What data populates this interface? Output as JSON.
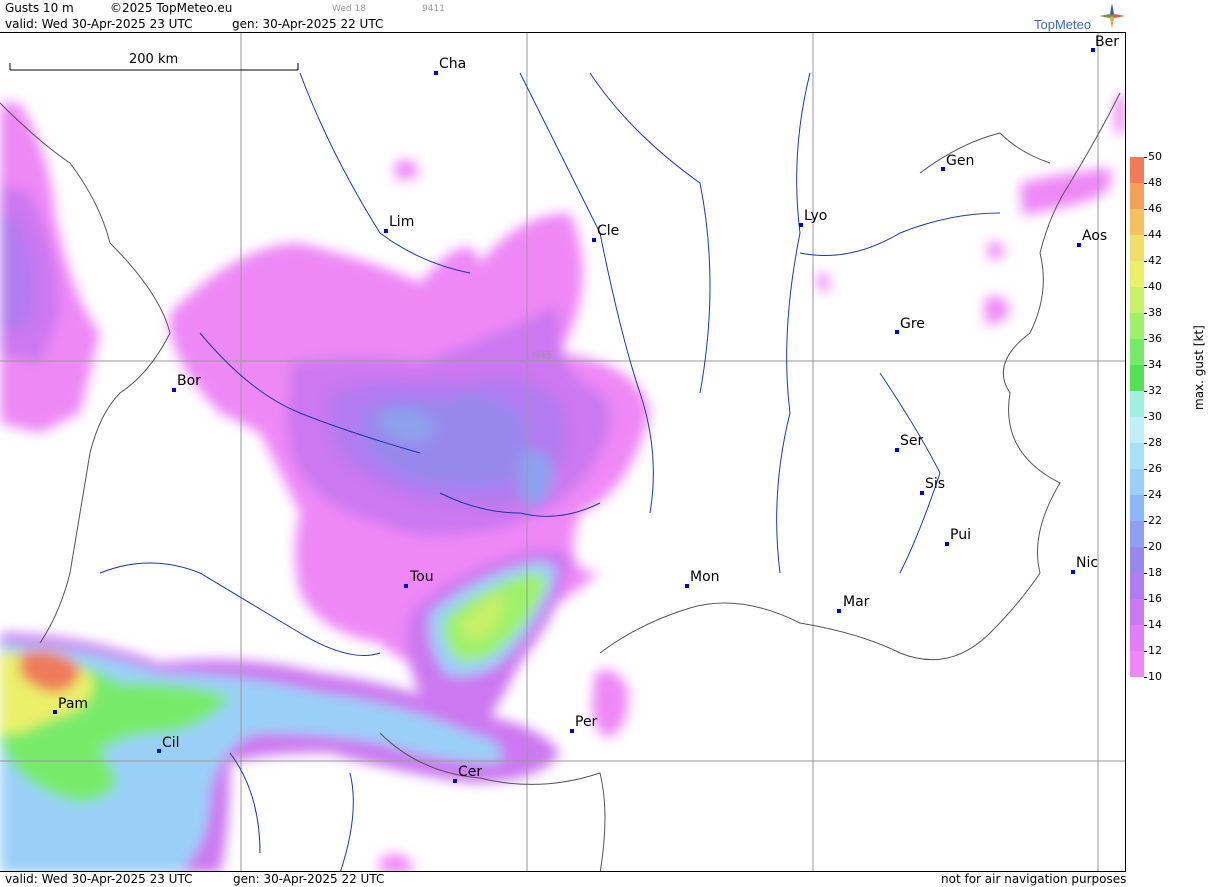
{
  "header": {
    "product": "Gusts 10 m",
    "copyright": "©2025 TopMeteo.eu",
    "faint_day": "Wed 18",
    "faint_code": "9411",
    "valid": "valid:  Wed  30-Apr-2025  23 UTC",
    "gen": "gen: 30-Apr-2025 22 UTC",
    "logo": "TopMeteo"
  },
  "map": {
    "scale_label": "200 km",
    "grid_label": "N45",
    "cities": [
      {
        "name": "Ber"
      },
      {
        "name": "Cha"
      },
      {
        "name": "Gen"
      },
      {
        "name": "Lim"
      },
      {
        "name": "Cle"
      },
      {
        "name": "Lyo"
      },
      {
        "name": "Aos"
      },
      {
        "name": "Gre"
      },
      {
        "name": "Bor"
      },
      {
        "name": "Ser"
      },
      {
        "name": "Sis"
      },
      {
        "name": "Pui"
      },
      {
        "name": "Nic"
      },
      {
        "name": "Tou"
      },
      {
        "name": "Mon"
      },
      {
        "name": "Mar"
      },
      {
        "name": "Pam"
      },
      {
        "name": "Per"
      },
      {
        "name": "Cil"
      },
      {
        "name": "Cer"
      }
    ]
  },
  "legend": {
    "title": "max. gust  [kt]",
    "ticks": [
      "50",
      "48",
      "46",
      "44",
      "42",
      "40",
      "38",
      "36",
      "34",
      "32",
      "30",
      "28",
      "26",
      "24",
      "22",
      "20",
      "18",
      "16",
      "14",
      "12",
      "10"
    ],
    "colors": [
      "#f07a5a",
      "#f2a05a",
      "#f4c062",
      "#f2dc6a",
      "#eaf06a",
      "#c8f06a",
      "#9ef06a",
      "#78ea6a",
      "#56e05a",
      "#9ff0e0",
      "#bfeff8",
      "#a8e2f8",
      "#9ad0f8",
      "#8cb8f4",
      "#8ea0ee",
      "#9888ec",
      "#b27cee",
      "#cc78f0",
      "#e07ef4",
      "#ee88f6"
    ]
  },
  "footer": {
    "valid": "valid:  Wed  30-Apr-2025  23 UTC",
    "gen": "gen: 30-Apr-2025 22 UTC",
    "disclaimer": "not for air navigation purposes"
  }
}
